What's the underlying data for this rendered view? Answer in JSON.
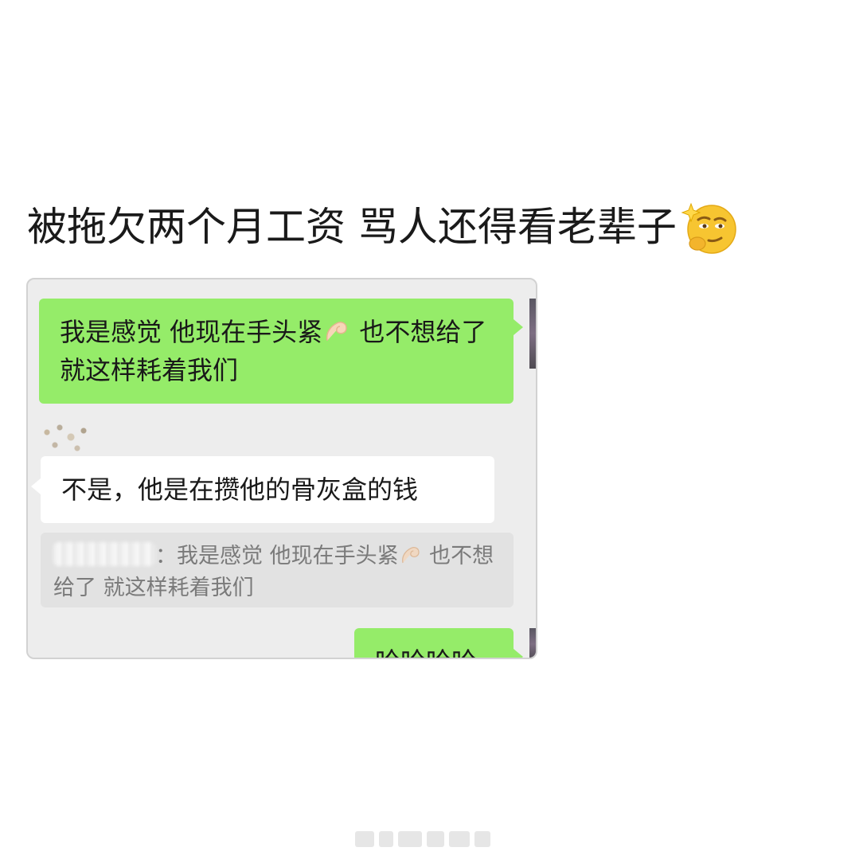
{
  "headline": {
    "text": "被拖欠两个月工资 骂人还得看老辈子"
  },
  "chat": {
    "outgoing_1": {
      "before_emoji": "我是感觉 他现在手头紧",
      "emoji": "pinched-fingers-emoji",
      "after_emoji": " 也不想给了 就这样耗着我们"
    },
    "incoming_1": {
      "text": "不是，他是在攒他的骨灰盒的钱"
    },
    "quote": {
      "separator": "：",
      "before_emoji": "我是感觉 他现在手头紧",
      "emoji": "pinched-fingers-emoji",
      "after_emoji": " 也不想给了 就这样耗着我们"
    },
    "outgoing_2": {
      "text": "哈哈哈哈"
    }
  },
  "icons": {
    "headline_emoji": "thinking-face-sparkle-emoji",
    "bubble_emoji": "pinched-fingers-emoji"
  },
  "colors": {
    "outgoing_bubble": "#95ec69",
    "incoming_bubble": "#ffffff",
    "chat_background": "#ededed",
    "quote_background": "#e2e2e2"
  }
}
